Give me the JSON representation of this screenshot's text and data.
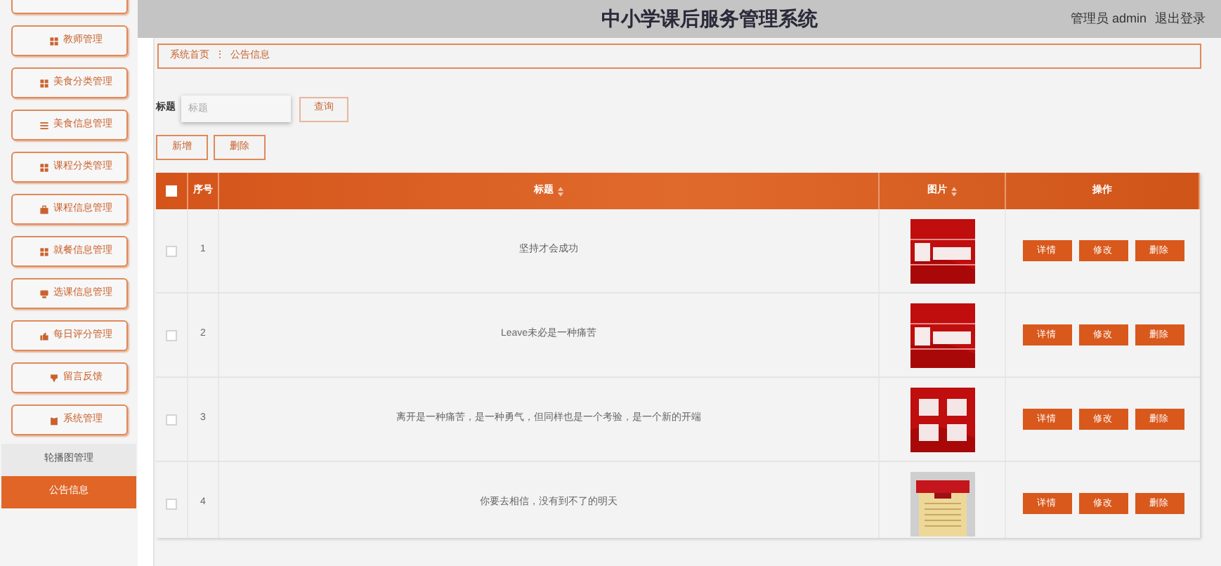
{
  "header": {
    "title": "中小学课后服务管理系统",
    "user": "管理员 admin",
    "logout": "退出登录"
  },
  "sidebar": {
    "items": [
      {
        "label": "教师管理"
      },
      {
        "label": "美食分类管理"
      },
      {
        "label": "美食信息管理"
      },
      {
        "label": "课程分类管理"
      },
      {
        "label": "课程信息管理"
      },
      {
        "label": "就餐信息管理"
      },
      {
        "label": "选课信息管理"
      },
      {
        "label": "每日评分管理"
      },
      {
        "label": "留言反馈"
      },
      {
        "label": "系统管理"
      }
    ],
    "subitems": [
      {
        "label": "轮播图管理",
        "selected": false
      },
      {
        "label": "公告信息",
        "selected": true
      }
    ]
  },
  "breadcrumb": {
    "home": "系统首页",
    "separator": "⋮",
    "current": "公告信息"
  },
  "search": {
    "label": "标题",
    "placeholder": "标题",
    "button": "查询"
  },
  "actions": [
    "新增",
    "删除"
  ],
  "table": {
    "all_checked": false,
    "columns": [
      {
        "label": "序号",
        "sortable": false
      },
      {
        "label": "标题",
        "sortable": true
      },
      {
        "label": "图片",
        "sortable": true
      },
      {
        "label": "操作",
        "sortable": false
      }
    ],
    "rows": [
      {
        "index": "1",
        "title": "坚持才会成功",
        "checked": false,
        "actions": [
          "详情",
          "修改",
          "删除"
        ]
      },
      {
        "index": "2",
        "title": "Leave未必是一种痛苦",
        "checked": false,
        "actions": [
          "详情",
          "修改",
          "删除"
        ]
      },
      {
        "index": "3",
        "title": "离开是一种痛苦，是一种勇气，但同样也是一个考验，是一个新的开端",
        "checked": false,
        "actions": [
          "详情",
          "修改",
          "删除"
        ]
      },
      {
        "index": "4",
        "title": "你要去相信，没有到不了的明天",
        "checked": false,
        "actions": [
          "详情",
          "修改",
          "删除"
        ]
      }
    ]
  }
}
